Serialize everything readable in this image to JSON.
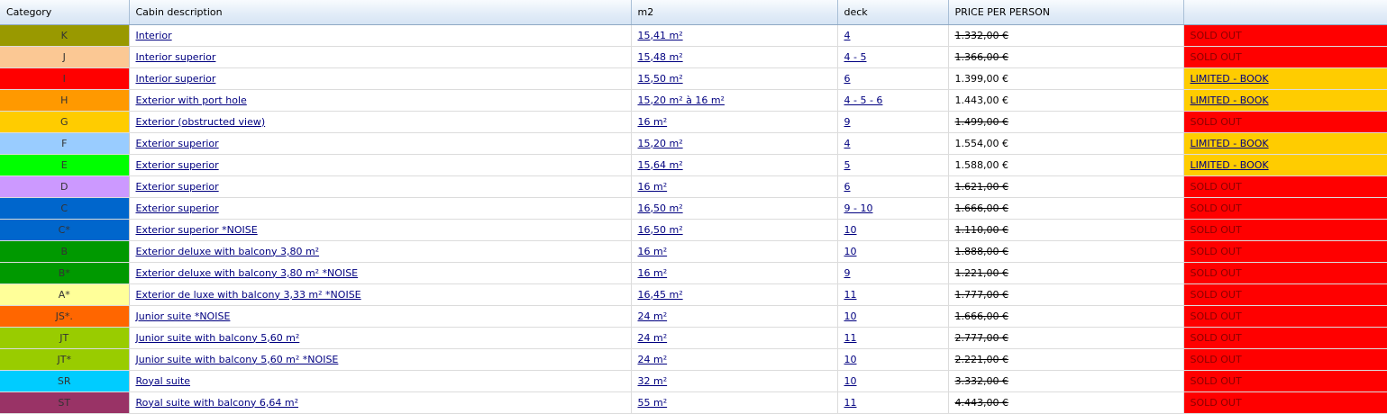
{
  "headers": {
    "category": "Category",
    "description": "Cabin description",
    "m2": "m2",
    "deck": "deck",
    "price": "PRICE PER PERSON",
    "status": ""
  },
  "colors": {
    "sold_out": "#ff0000",
    "limited": "#ffcc00"
  },
  "rows": [
    {
      "category": "K",
      "color": "#999900",
      "description": "Interior",
      "m2": "15,41 m²",
      "deck": "4",
      "price": "1.332,00 €",
      "price_struck": true,
      "status": "SOLD OUT",
      "status_type": "sold"
    },
    {
      "category": "J",
      "color": "#fbc894",
      "description": "Interior superior",
      "m2": "15,48 m²",
      "deck": "4 - 5",
      "price": "1.366,00 €",
      "price_struck": true,
      "status": "SOLD OUT",
      "status_type": "sold"
    },
    {
      "category": "I",
      "color": "#ff0000",
      "description": "Interior superior",
      "m2": "15,50 m²",
      "deck": "6",
      "price": "1.399,00 €",
      "price_struck": false,
      "status": "LIMITED - BOOK",
      "status_type": "limited"
    },
    {
      "category": "H",
      "color": "#ff9900",
      "description": "Exterior with port hole",
      "m2": "15,20 m² à 16 m²",
      "deck": "4 - 5 - 6",
      "price": "1.443,00 €",
      "price_struck": false,
      "status": "LIMITED - BOOK",
      "status_type": "limited"
    },
    {
      "category": "G",
      "color": "#ffcc00",
      "description": "Exterior (obstructed view)",
      "m2": "16 m²",
      "deck": "9",
      "price": "1.499,00 €",
      "price_struck": true,
      "status": "SOLD OUT",
      "status_type": "sold"
    },
    {
      "category": "F",
      "color": "#99ccff",
      "description": "Exterior superior",
      "m2": "15,20 m²",
      "deck": "4",
      "price": "1.554,00 €",
      "price_struck": false,
      "status": "LIMITED - BOOK",
      "status_type": "limited"
    },
    {
      "category": "E",
      "color": "#00ff00",
      "description": "Exterior superior",
      "m2": "15,64 m²",
      "deck": "5",
      "price": "1.588,00 €",
      "price_struck": false,
      "status": "LIMITED - BOOK",
      "status_type": "limited"
    },
    {
      "category": "D",
      "color": "#cc99ff",
      "description": "Exterior superior",
      "m2": "16 m²",
      "deck": "6",
      "price": "1.621,00 €",
      "price_struck": true,
      "status": "SOLD OUT",
      "status_type": "sold"
    },
    {
      "category": "C",
      "color": "#0066cc",
      "description": "Exterior superior",
      "m2": "16,50 m²",
      "deck": "9 - 10",
      "price": "1.666,00 €",
      "price_struck": true,
      "status": "SOLD OUT",
      "status_type": "sold"
    },
    {
      "category": "C*",
      "color": "#0066cc",
      "description": "Exterior superior *NOISE",
      "m2": "16,50 m²",
      "deck": "10",
      "price": "1.110,00 €",
      "price_struck": true,
      "status": "SOLD OUT",
      "status_type": "sold"
    },
    {
      "category": "B",
      "color": "#009900",
      "description": "Exterior deluxe with balcony 3,80 m²",
      "m2": "16 m²",
      "deck": "10",
      "price": "1.888,00 €",
      "price_struck": true,
      "status": "SOLD OUT",
      "status_type": "sold"
    },
    {
      "category": "B*",
      "color": "#009900",
      "description": "Exterior deluxe with balcony 3,80 m² *NOISE",
      "m2": "16 m²",
      "deck": "9",
      "price": "1.221,00 €",
      "price_struck": true,
      "status": "SOLD OUT",
      "status_type": "sold"
    },
    {
      "category": "A*",
      "color": "#ffff99",
      "description": "Exterior de luxe with balcony 3,33 m² *NOISE",
      "m2": "16,45 m²",
      "deck": "11",
      "price": "1.777,00 €",
      "price_struck": true,
      "status": "SOLD OUT",
      "status_type": "sold"
    },
    {
      "category": "JS*.",
      "color": "#ff6600",
      "description": "Junior suite *NOISE",
      "m2": "24 m²",
      "deck": "10",
      "price": "1.666,00 €",
      "price_struck": true,
      "status": "SOLD OUT",
      "status_type": "sold"
    },
    {
      "category": "JT",
      "color": "#99cc00",
      "description": "Junior suite with balcony 5,60 m²",
      "m2": "24 m²",
      "deck": "11",
      "price": "2.777,00 €",
      "price_struck": true,
      "status": "SOLD OUT",
      "status_type": "sold"
    },
    {
      "category": "JT*",
      "color": "#99cc00",
      "description": "Junior suite with balcony 5,60 m² *NOISE",
      "m2": "24 m²",
      "deck": "10",
      "price": "2.221,00 €",
      "price_struck": true,
      "status": "SOLD OUT",
      "status_type": "sold"
    },
    {
      "category": "SR",
      "color": "#00ccff",
      "description": "Royal suite",
      "m2": "32 m²",
      "deck": "10",
      "price": "3.332,00 €",
      "price_struck": true,
      "status": "SOLD OUT",
      "status_type": "sold"
    },
    {
      "category": "ST",
      "color": "#993366",
      "description": "Royal suite with balcony 6,64 m²",
      "m2": "55 m²",
      "deck": "11",
      "price": "4.443,00 €",
      "price_struck": true,
      "status": "SOLD OUT",
      "status_type": "sold"
    }
  ]
}
